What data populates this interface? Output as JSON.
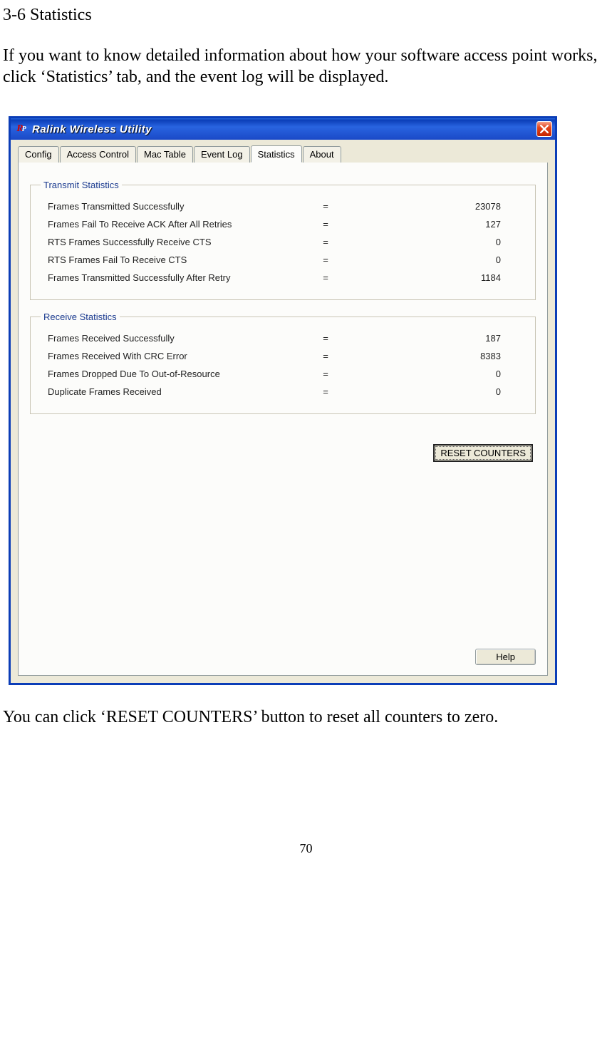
{
  "doc": {
    "heading": "3-6 Statistics",
    "intro": "If you want to know detailed information about how your software access point works, click ‘Statistics’ tab, and the event log will be displayed.",
    "footer": "You can click ‘RESET COUNTERS’ button to reset all counters to zero.",
    "page_number": "70"
  },
  "window": {
    "title": "Ralink Wireless Utility",
    "close_tooltip": "Close"
  },
  "tabs": {
    "config": "Config",
    "access_control": "Access Control",
    "mac_table": "Mac Table",
    "event_log": "Event Log",
    "statistics": "Statistics",
    "about": "About",
    "active": "statistics"
  },
  "transmit": {
    "legend": "Transmit Statistics",
    "rows": [
      {
        "label": "Frames Transmitted Successfully",
        "value": "23078"
      },
      {
        "label": "Frames Fail To Receive ACK After All Retries",
        "value": "127"
      },
      {
        "label": "RTS Frames Successfully Receive CTS",
        "value": "0"
      },
      {
        "label": "RTS Frames Fail To Receive CTS",
        "value": "0"
      },
      {
        "label": "Frames Transmitted Successfully After Retry",
        "value": "1184"
      }
    ]
  },
  "receive": {
    "legend": "Receive Statistics",
    "rows": [
      {
        "label": "Frames Received Successfully",
        "value": "187"
      },
      {
        "label": "Frames Received With CRC Error",
        "value": "8383"
      },
      {
        "label": "Frames Dropped Due To Out-of-Resource",
        "value": "0"
      },
      {
        "label": "Duplicate Frames Received",
        "value": "0"
      }
    ]
  },
  "buttons": {
    "reset": "RESET COUNTERS",
    "help": "Help"
  },
  "eq": "="
}
